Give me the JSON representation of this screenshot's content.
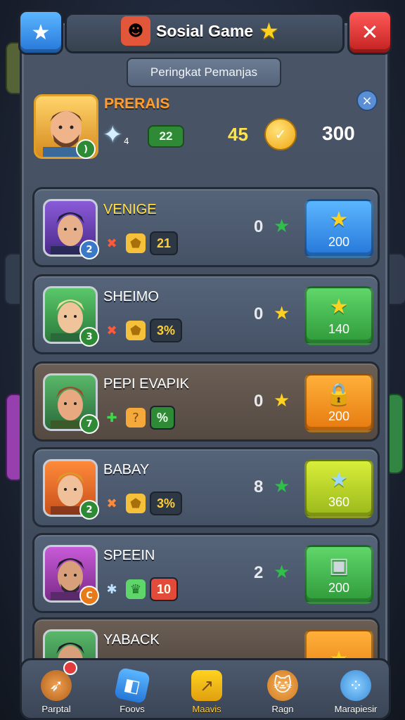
{
  "header": {
    "title": "Sosial Game",
    "subtitle": "Peringkat Pemanjas",
    "menu_icon": "star-badge-icon",
    "close_icon": "close-x-icon"
  },
  "summary": {
    "name": "PRERAIS",
    "gem_count": "22",
    "score": "45",
    "total": "300"
  },
  "rows": [
    {
      "name": "VENIGE",
      "rank": "2",
      "stat": "21",
      "score": "0",
      "action_value": "200"
    },
    {
      "name": "SHEIMO",
      "rank": "3",
      "stat": "3%",
      "score": "0",
      "action_value": "140"
    },
    {
      "name": "PEPI EVAPIK",
      "rank": "7",
      "stat": "%",
      "score": "0",
      "action_value": "200"
    },
    {
      "name": "BABAY",
      "rank": "2",
      "stat": "3%",
      "score": "8",
      "action_value": "360"
    },
    {
      "name": "SPEEIN",
      "rank": "C",
      "stat": "10",
      "score": "2",
      "action_value": "200"
    },
    {
      "name": "YABACK",
      "rank": "",
      "stat": "",
      "score": "",
      "action_value": ""
    }
  ],
  "nav": [
    {
      "label": "Parptal",
      "icon": "arrow-icon"
    },
    {
      "label": "Foovs",
      "icon": "cube-icon"
    },
    {
      "label": "Maavis",
      "icon": "arrow-fold-icon"
    },
    {
      "label": "Ragn",
      "icon": "cat-icon"
    },
    {
      "label": "Marapiesir",
      "icon": "dots-icon"
    }
  ],
  "colors": {
    "accent_gold": "#ffd21f",
    "button_blue": "#2677d8",
    "button_green": "#3aa23f",
    "button_orange": "#f08a14",
    "button_lime": "#b6d21c",
    "close_red": "#c21f1f"
  }
}
